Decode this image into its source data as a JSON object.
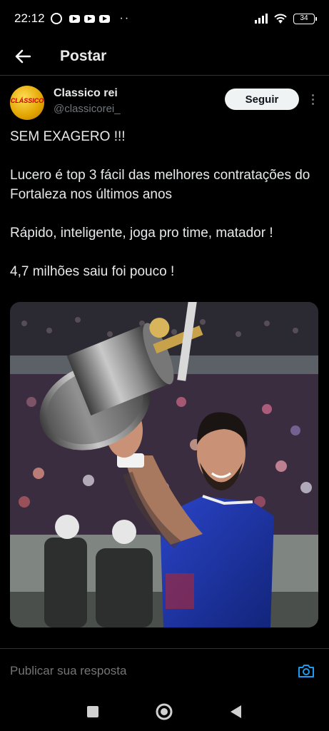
{
  "status_bar": {
    "time": "22:12",
    "overflow": "··",
    "battery": "34"
  },
  "header": {
    "title": "Postar",
    "back_icon": "arrow-left-icon"
  },
  "tweet": {
    "author_name": "Classico rei",
    "author_handle": "@classicorei_",
    "avatar_text": "CLÁSSICO",
    "follow_label": "Seguir",
    "paragraphs": [
      "SEM EXAGERO !!!",
      "Lucero é top 3 fácil das melhores contratações do Fortaleza nos últimos anos",
      "Rápido, inteligente, joga pro time, matador !",
      "4,7 milhões saiu foi pouco !"
    ],
    "image_alt": "photo-player-holding-trophy"
  },
  "reply": {
    "placeholder": "Publicar sua resposta",
    "camera_icon": "camera-icon"
  },
  "nav": {
    "recents_icon": "square-icon",
    "home_icon": "circle-icon",
    "back_icon": "triangle-back-icon"
  },
  "colors": {
    "background": "#000000",
    "text": "#e7e9ea",
    "secondary": "#71767b",
    "accent": "#1d9bf0",
    "divider": "#2f3336"
  }
}
